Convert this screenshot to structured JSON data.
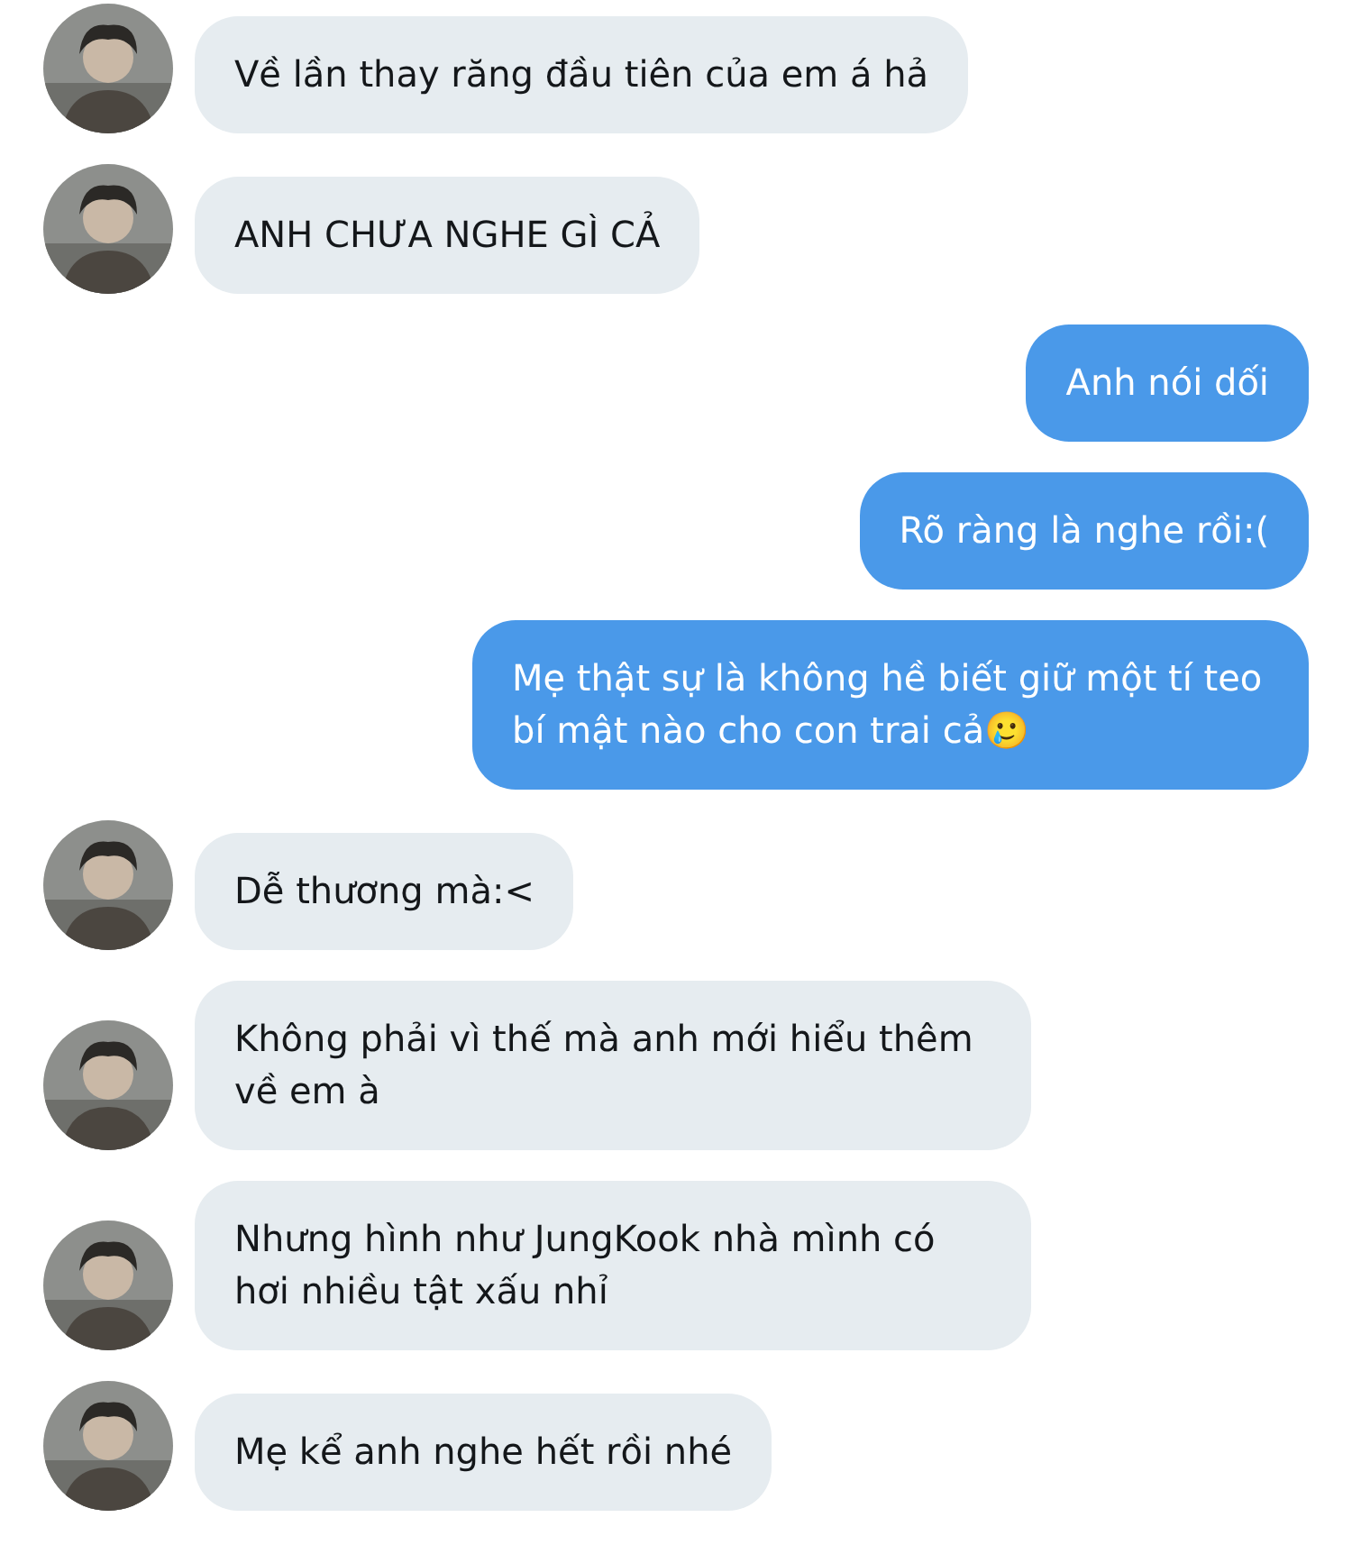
{
  "messages": [
    {
      "kind": "incoming",
      "text": "Về lần thay răng đầu tiên của em á hả"
    },
    {
      "kind": "incoming",
      "text": "ANH CHƯA NGHE GÌ CẢ"
    },
    {
      "kind": "outgoing",
      "text": "Anh nói dối"
    },
    {
      "kind": "outgoing",
      "text": "Rõ ràng là nghe rồi:("
    },
    {
      "kind": "outgoing",
      "text": "Mẹ thật sự là không hề biết giữ một tí teo bí mật nào cho con trai cả🥲"
    },
    {
      "kind": "incoming",
      "text": "Dễ thương mà:<"
    },
    {
      "kind": "incoming",
      "text": "Không phải vì thế mà anh mới hiểu thêm về em à"
    },
    {
      "kind": "incoming",
      "text": "Nhưng hình như JungKook nhà mình có hơi nhiều tật xấu nhỉ"
    },
    {
      "kind": "incoming",
      "text": "Mẹ kể anh nghe hết rồi nhé"
    }
  ]
}
